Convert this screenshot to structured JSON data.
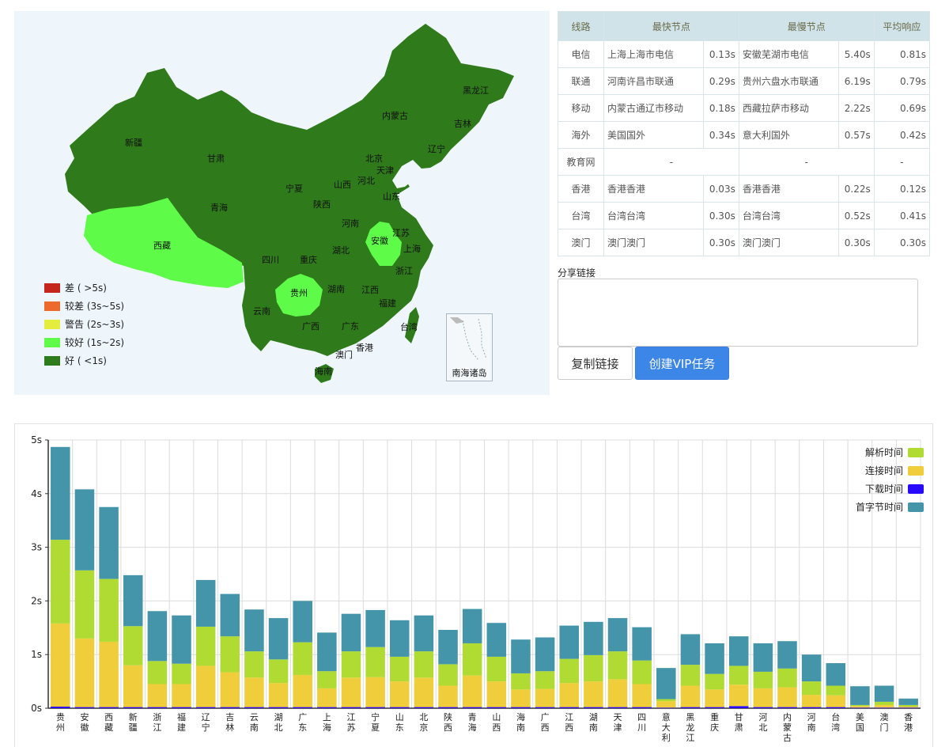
{
  "map": {
    "provinces": [
      {
        "name": "黑龙江",
        "color": "#2f7a1a"
      },
      {
        "name": "吉林",
        "color": "#2f7a1a"
      },
      {
        "name": "辽宁",
        "color": "#2f7a1a"
      },
      {
        "name": "内蒙古",
        "color": "#2f7a1a"
      },
      {
        "name": "新疆",
        "color": "#2f7a1a"
      },
      {
        "name": "甘肃",
        "color": "#2f7a1a"
      },
      {
        "name": "青海",
        "color": "#2f7a1a"
      },
      {
        "name": "宁夏",
        "color": "#2f7a1a"
      },
      {
        "name": "北京",
        "color": "#2f7a1a"
      },
      {
        "name": "天津",
        "color": "#2f7a1a"
      },
      {
        "name": "山西",
        "color": "#2f7a1a"
      },
      {
        "name": "河北",
        "color": "#2f7a1a"
      },
      {
        "name": "山东",
        "color": "#2f7a1a"
      },
      {
        "name": "陕西",
        "color": "#2f7a1a"
      },
      {
        "name": "河南",
        "color": "#2f7a1a"
      },
      {
        "name": "江苏",
        "color": "#2f7a1a"
      },
      {
        "name": "安徽",
        "color": "#5efb49"
      },
      {
        "name": "上海",
        "color": "#2f7a1a"
      },
      {
        "name": "西藏",
        "color": "#5efb49"
      },
      {
        "name": "四川",
        "color": "#2f7a1a"
      },
      {
        "name": "重庆",
        "color": "#2f7a1a"
      },
      {
        "name": "湖北",
        "color": "#2f7a1a"
      },
      {
        "name": "浙江",
        "color": "#2f7a1a"
      },
      {
        "name": "贵州",
        "color": "#5efb49"
      },
      {
        "name": "湖南",
        "color": "#2f7a1a"
      },
      {
        "name": "江西",
        "color": "#2f7a1a"
      },
      {
        "name": "福建",
        "color": "#2f7a1a"
      },
      {
        "name": "云南",
        "color": "#2f7a1a"
      },
      {
        "name": "广西",
        "color": "#2f7a1a"
      },
      {
        "name": "广东",
        "color": "#2f7a1a"
      },
      {
        "name": "台湾",
        "color": "#2f7a1a"
      },
      {
        "name": "澳门",
        "color": "#2f7a1a"
      },
      {
        "name": "香港",
        "color": "#2f7a1a"
      },
      {
        "name": "海南",
        "color": "#2f7a1a"
      }
    ],
    "legend": [
      {
        "label": "差 ( >5s)",
        "color": "#c4261d"
      },
      {
        "label": "较差 (3s~5s)",
        "color": "#eb6a2c"
      },
      {
        "label": "警告 (2s~3s)",
        "color": "#e4ec3c"
      },
      {
        "label": "较好 (1s~2s)",
        "color": "#5efb49"
      },
      {
        "label": "好 ( <1s)",
        "color": "#2f7a1a"
      }
    ],
    "inset_label": "南海诸岛"
  },
  "table": {
    "headers": [
      "线路",
      "最快节点",
      "最慢节点",
      "平均响应"
    ],
    "rows": [
      {
        "line": "电信",
        "fast_node": "上海上海市电信",
        "fast_time": "0.13s",
        "slow_node": "安徽芜湖市电信",
        "slow_time": "5.40s",
        "avg": "0.81s"
      },
      {
        "line": "联通",
        "fast_node": "河南许昌市联通",
        "fast_time": "0.29s",
        "slow_node": "贵州六盘水市联通",
        "slow_time": "6.19s",
        "avg": "0.79s"
      },
      {
        "line": "移动",
        "fast_node": "内蒙古通辽市移动",
        "fast_time": "0.18s",
        "slow_node": "西藏拉萨市移动",
        "slow_time": "2.22s",
        "avg": "0.69s"
      },
      {
        "line": "海外",
        "fast_node": "美国国外",
        "fast_time": "0.34s",
        "slow_node": "意大利国外",
        "slow_time": "0.57s",
        "avg": "0.42s"
      },
      {
        "line": "教育网",
        "fast_node": "-",
        "fast_time": "",
        "slow_node": "-",
        "slow_time": "",
        "avg": "-"
      },
      {
        "line": "香港",
        "fast_node": "香港香港",
        "fast_time": "0.03s",
        "slow_node": "香港香港",
        "slow_time": "0.22s",
        "avg": "0.12s"
      },
      {
        "line": "台湾",
        "fast_node": "台湾台湾",
        "fast_time": "0.30s",
        "slow_node": "台湾台湾",
        "slow_time": "0.52s",
        "avg": "0.41s"
      },
      {
        "line": "澳门",
        "fast_node": "澳门澳门",
        "fast_time": "0.30s",
        "slow_node": "澳门澳门",
        "slow_time": "0.30s",
        "avg": "0.30s"
      }
    ]
  },
  "share": {
    "label": "分享链接",
    "value": "",
    "copy_label": "复制链接",
    "vip_label": "创建VIP任务"
  },
  "chart_data": {
    "type": "bar",
    "stacked": true,
    "ylim": [
      0,
      5
    ],
    "yticks": [
      "0s",
      "1s",
      "2s",
      "3s",
      "4s",
      "5s"
    ],
    "grid": true,
    "legend_position": "top-right",
    "categories": [
      "贵州",
      "安徽",
      "西藏",
      "新疆",
      "浙江",
      "福建",
      "辽宁",
      "吉林",
      "云南",
      "湖北",
      "广东",
      "上海",
      "江苏",
      "宁夏",
      "山东",
      "北京",
      "陕西",
      "青海",
      "山西",
      "海南",
      "广西",
      "江西",
      "湖南",
      "天津",
      "四川",
      "意大利",
      "黑龙江",
      "重庆",
      "甘肃",
      "河北",
      "内蒙古",
      "河南",
      "台湾",
      "美国",
      "澳门",
      "香港"
    ],
    "series": [
      {
        "name": "下载时间",
        "color": "#2a0aff",
        "values": [
          0.03,
          0.02,
          0.02,
          0.02,
          0.02,
          0.02,
          0.02,
          0.02,
          0.02,
          0.02,
          0.02,
          0.02,
          0.02,
          0.02,
          0.02,
          0.02,
          0.02,
          0.02,
          0.02,
          0.02,
          0.02,
          0.02,
          0.02,
          0.02,
          0.02,
          0.01,
          0.02,
          0.02,
          0.04,
          0.02,
          0.02,
          0.02,
          0.02,
          0.01,
          0.01,
          0.01
        ]
      },
      {
        "name": "连接时间",
        "color": "#f0ce3b",
        "values": [
          1.55,
          1.28,
          1.22,
          0.78,
          0.43,
          0.43,
          0.77,
          0.65,
          0.55,
          0.45,
          0.6,
          0.35,
          0.55,
          0.56,
          0.48,
          0.55,
          0.4,
          0.59,
          0.48,
          0.33,
          0.34,
          0.45,
          0.48,
          0.52,
          0.43,
          0.12,
          0.4,
          0.33,
          0.4,
          0.35,
          0.37,
          0.23,
          0.22,
          0.03,
          0.05,
          0.02
        ]
      },
      {
        "name": "解析时间",
        "color": "#afdb33",
        "values": [
          1.56,
          1.27,
          1.17,
          0.73,
          0.43,
          0.38,
          0.73,
          0.67,
          0.49,
          0.44,
          0.61,
          0.32,
          0.49,
          0.56,
          0.46,
          0.49,
          0.4,
          0.6,
          0.46,
          0.3,
          0.33,
          0.45,
          0.49,
          0.52,
          0.44,
          0.04,
          0.39,
          0.29,
          0.35,
          0.31,
          0.35,
          0.25,
          0.18,
          0.02,
          0.06,
          0.03
        ]
      },
      {
        "name": "首字节时间",
        "color": "#4494aa",
        "values": [
          1.73,
          1.51,
          1.34,
          0.95,
          0.93,
          0.9,
          0.87,
          0.79,
          0.78,
          0.77,
          0.77,
          0.72,
          0.7,
          0.69,
          0.68,
          0.67,
          0.64,
          0.64,
          0.63,
          0.63,
          0.63,
          0.62,
          0.62,
          0.62,
          0.62,
          0.58,
          0.57,
          0.57,
          0.55,
          0.53,
          0.51,
          0.5,
          0.42,
          0.35,
          0.3,
          0.12
        ]
      }
    ],
    "legend_order": [
      "解析时间",
      "连接时间",
      "下载时间",
      "首字节时间"
    ]
  }
}
